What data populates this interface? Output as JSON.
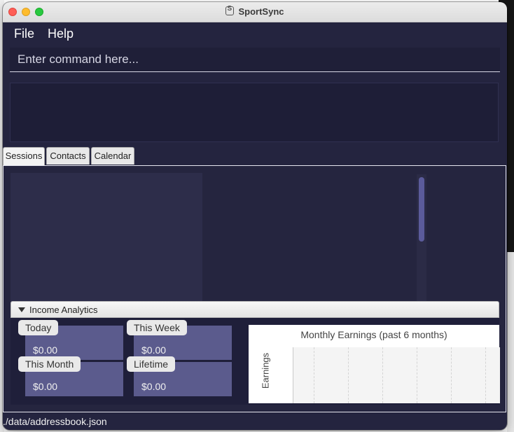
{
  "window": {
    "title": "SportSync"
  },
  "menu": {
    "file": "File",
    "help": "Help"
  },
  "command": {
    "placeholder": "Enter command here..."
  },
  "tabs": [
    {
      "label": "Sessions",
      "active": true
    },
    {
      "label": "Contacts",
      "active": false
    },
    {
      "label": "Calendar",
      "active": false
    }
  ],
  "income": {
    "header": "Income Analytics",
    "cards": [
      {
        "label": "Today",
        "value": "$0.00"
      },
      {
        "label": "This Week",
        "value": "$0.00"
      },
      {
        "label": "This Month",
        "value": "$0.00"
      },
      {
        "label": "Lifetime",
        "value": "$0.00"
      }
    ]
  },
  "chart_data": {
    "type": "bar",
    "title": "Monthly Earnings (past 6 months)",
    "ylabel": "Earnings",
    "xlabel": "",
    "categories": [],
    "values": []
  },
  "status": {
    "path": "./data/addressbook.json"
  },
  "colors": {
    "window_bg": "#24243f",
    "card_bg": "#5b5b8d",
    "scroll_thumb": "#5b5b9b"
  }
}
